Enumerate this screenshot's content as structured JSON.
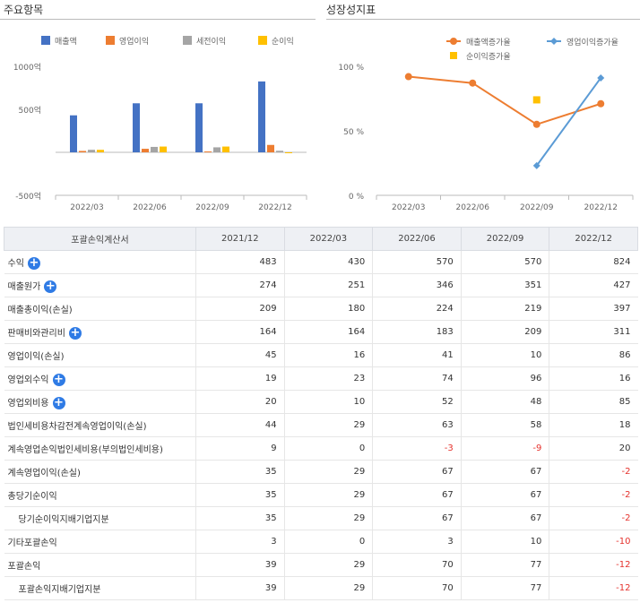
{
  "left_title": "주요항목",
  "right_title": "성장성지표",
  "chart_data": [
    {
      "type": "bar",
      "categories": [
        "2022/03",
        "2022/06",
        "2022/09",
        "2022/12"
      ],
      "series": [
        {
          "name": "매출액",
          "values": [
            430,
            570,
            570,
            824
          ],
          "color": "#4472c4"
        },
        {
          "name": "영업이익",
          "values": [
            16,
            41,
            10,
            86
          ],
          "color": "#ed7d31"
        },
        {
          "name": "세전이익",
          "values": [
            29,
            63,
            58,
            18
          ],
          "color": "#a5a5a5"
        },
        {
          "name": "순이익",
          "values": [
            29,
            67,
            67,
            -2
          ],
          "color": "#ffc000"
        }
      ],
      "ylim": [
        -500,
        1000
      ],
      "yticks": [
        {
          "v": 1000,
          "label": "1000억"
        },
        {
          "v": 500,
          "label": "500억"
        },
        {
          "v": 0,
          "label": ""
        },
        {
          "v": -500,
          "label": "-500억"
        }
      ],
      "legend": "top"
    },
    {
      "type": "line",
      "categories": [
        "2022/03",
        "2022/06",
        "2022/09",
        "2022/12"
      ],
      "series": [
        {
          "name": "매출액증가율",
          "values": [
            92,
            87,
            55,
            71
          ],
          "color": "#ed7d31",
          "marker": "circle"
        },
        {
          "name": "영업이익증가율",
          "values": [
            null,
            null,
            23,
            91
          ],
          "color": "#5b9bd5",
          "marker": "diamond"
        },
        {
          "name": "순이익증가율",
          "values": [
            null,
            null,
            74,
            null
          ],
          "color": "#ffc000",
          "marker": "square"
        }
      ],
      "ylim": [
        0,
        100
      ],
      "yticks": [
        {
          "v": 100,
          "label": "100 %"
        },
        {
          "v": 50,
          "label": "50 %"
        },
        {
          "v": 0,
          "label": "0 %"
        }
      ],
      "legend": "top"
    }
  ],
  "table": {
    "headers": [
      "포괄손익계산서",
      "2021/12",
      "2022/03",
      "2022/06",
      "2022/09",
      "2022/12"
    ],
    "rows": [
      {
        "label": "수익",
        "plus": true,
        "indent": false,
        "values": [
          "483",
          "430",
          "570",
          "570",
          "824"
        ]
      },
      {
        "label": "매출원가",
        "plus": true,
        "indent": false,
        "values": [
          "274",
          "251",
          "346",
          "351",
          "427"
        ]
      },
      {
        "label": "매출총이익(손실)",
        "plus": false,
        "indent": false,
        "values": [
          "209",
          "180",
          "224",
          "219",
          "397"
        ]
      },
      {
        "label": "판매비와관리비",
        "plus": true,
        "indent": false,
        "values": [
          "164",
          "164",
          "183",
          "209",
          "311"
        ]
      },
      {
        "label": "영업이익(손실)",
        "plus": false,
        "indent": false,
        "values": [
          "45",
          "16",
          "41",
          "10",
          "86"
        ]
      },
      {
        "label": "영업외수익",
        "plus": true,
        "indent": false,
        "values": [
          "19",
          "23",
          "74",
          "96",
          "16"
        ]
      },
      {
        "label": "영업외비용",
        "plus": true,
        "indent": false,
        "values": [
          "20",
          "10",
          "52",
          "48",
          "85"
        ]
      },
      {
        "label": "법인세비용차감전계속영업이익(손실)",
        "plus": false,
        "indent": false,
        "values": [
          "44",
          "29",
          "63",
          "58",
          "18"
        ]
      },
      {
        "label": "계속영업손익법인세비용(부의법인세비용)",
        "plus": false,
        "indent": false,
        "values": [
          "9",
          "0",
          "-3",
          "-9",
          "20"
        ]
      },
      {
        "label": "계속영업이익(손실)",
        "plus": false,
        "indent": false,
        "values": [
          "35",
          "29",
          "67",
          "67",
          "-2"
        ]
      },
      {
        "label": "총당기순이익",
        "plus": false,
        "indent": false,
        "values": [
          "35",
          "29",
          "67",
          "67",
          "-2"
        ]
      },
      {
        "label": "당기순이익지배기업지분",
        "plus": false,
        "indent": true,
        "values": [
          "35",
          "29",
          "67",
          "67",
          "-2"
        ]
      },
      {
        "label": "기타포괄손익",
        "plus": false,
        "indent": false,
        "values": [
          "3",
          "0",
          "3",
          "10",
          "-10"
        ]
      },
      {
        "label": "포괄손익",
        "plus": false,
        "indent": false,
        "values": [
          "39",
          "29",
          "70",
          "77",
          "-12"
        ]
      },
      {
        "label": "포괄손익지배기업지분",
        "plus": false,
        "indent": true,
        "values": [
          "39",
          "29",
          "70",
          "77",
          "-12"
        ]
      }
    ]
  }
}
